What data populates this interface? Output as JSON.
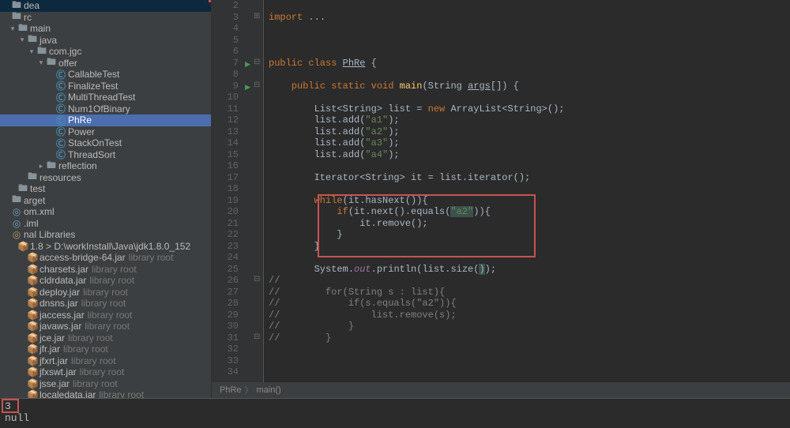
{
  "sidebar": {
    "items": [
      {
        "indent": 0,
        "arrow": "",
        "icon": "F",
        "iconClass": "ic-folder",
        "label": "dea"
      },
      {
        "indent": 0,
        "arrow": "",
        "icon": "F",
        "iconClass": "ic-folder",
        "label": "rc"
      },
      {
        "indent": 1,
        "arrow": "▾",
        "icon": "F",
        "iconClass": "ic-folder",
        "label": "main"
      },
      {
        "indent": 2,
        "arrow": "▾",
        "icon": "F",
        "iconClass": "ic-folder",
        "label": "java"
      },
      {
        "indent": 3,
        "arrow": "▾",
        "icon": "P",
        "iconClass": "ic-package",
        "label": "com.jgc"
      },
      {
        "indent": 4,
        "arrow": "▾",
        "icon": "P",
        "iconClass": "ic-package",
        "label": "offer"
      },
      {
        "indent": 5,
        "arrow": "",
        "icon": "C",
        "iconClass": "ic-class",
        "label": "CallableTest"
      },
      {
        "indent": 5,
        "arrow": "",
        "icon": "C",
        "iconClass": "ic-class",
        "label": "FinalizeTest"
      },
      {
        "indent": 5,
        "arrow": "",
        "icon": "C",
        "iconClass": "ic-class",
        "label": "MultiThreadTest"
      },
      {
        "indent": 5,
        "arrow": "",
        "icon": "C",
        "iconClass": "ic-class",
        "label": "Num1OfBinary"
      },
      {
        "indent": 5,
        "arrow": "",
        "icon": "C",
        "iconClass": "ic-class",
        "label": "PhRe",
        "selected": true
      },
      {
        "indent": 5,
        "arrow": "",
        "icon": "C",
        "iconClass": "ic-class",
        "label": "Power"
      },
      {
        "indent": 5,
        "arrow": "",
        "icon": "C",
        "iconClass": "ic-class",
        "label": "StackOnTest"
      },
      {
        "indent": 5,
        "arrow": "",
        "icon": "C",
        "iconClass": "ic-class",
        "label": "ThreadSort"
      },
      {
        "indent": 4,
        "arrow": "▸",
        "icon": "P",
        "iconClass": "ic-package",
        "label": "reflection"
      },
      {
        "indent": 2,
        "arrow": "",
        "icon": "F",
        "iconClass": "ic-folder",
        "label": "resources"
      },
      {
        "indent": 1,
        "arrow": "",
        "icon": "F",
        "iconClass": "ic-folder",
        "label": "test"
      },
      {
        "indent": 0,
        "arrow": "",
        "icon": "F",
        "iconClass": "ic-folder",
        "label": "arget"
      },
      {
        "indent": 0,
        "arrow": "",
        "icon": "x",
        "iconClass": "ic-xml",
        "label": "om.xml"
      },
      {
        "indent": 0,
        "arrow": "",
        "icon": "i",
        "iconClass": "ic-xml",
        "label": ".iml"
      },
      {
        "indent": 0,
        "arrow": "",
        "icon": "L",
        "iconClass": "ic-lib",
        "label": "nal Libraries"
      },
      {
        "indent": 1,
        "arrow": "",
        "icon": "J",
        "iconClass": "ic-jar",
        "label": "1.8 > D:\\workInstall\\Java\\jdk1.8.0_152"
      },
      {
        "indent": 2,
        "arrow": "",
        "icon": "J",
        "iconClass": "ic-jar",
        "label": "access-bridge-64.jar",
        "note": "library root"
      },
      {
        "indent": 2,
        "arrow": "",
        "icon": "J",
        "iconClass": "ic-jar",
        "label": "charsets.jar",
        "note": "library root"
      },
      {
        "indent": 2,
        "arrow": "",
        "icon": "J",
        "iconClass": "ic-jar",
        "label": "cldrdata.jar",
        "note": "library root"
      },
      {
        "indent": 2,
        "arrow": "",
        "icon": "J",
        "iconClass": "ic-jar",
        "label": "deploy.jar",
        "note": "library root"
      },
      {
        "indent": 2,
        "arrow": "",
        "icon": "J",
        "iconClass": "ic-jar",
        "label": "dnsns.jar",
        "note": "library root"
      },
      {
        "indent": 2,
        "arrow": "",
        "icon": "J",
        "iconClass": "ic-jar",
        "label": "jaccess.jar",
        "note": "library root"
      },
      {
        "indent": 2,
        "arrow": "",
        "icon": "J",
        "iconClass": "ic-jar",
        "label": "javaws.jar",
        "note": "library root"
      },
      {
        "indent": 2,
        "arrow": "",
        "icon": "J",
        "iconClass": "ic-jar",
        "label": "jce.jar",
        "note": "library root"
      },
      {
        "indent": 2,
        "arrow": "",
        "icon": "J",
        "iconClass": "ic-jar",
        "label": "jfr.jar",
        "note": "library root"
      },
      {
        "indent": 2,
        "arrow": "",
        "icon": "J",
        "iconClass": "ic-jar",
        "label": "jfxrt.jar",
        "note": "library root"
      },
      {
        "indent": 2,
        "arrow": "",
        "icon": "J",
        "iconClass": "ic-jar",
        "label": "jfxswt.jar",
        "note": "library root"
      },
      {
        "indent": 2,
        "arrow": "",
        "icon": "J",
        "iconClass": "ic-jar",
        "label": "jsse.jar",
        "note": "library root"
      },
      {
        "indent": 2,
        "arrow": "",
        "icon": "J",
        "iconClass": "ic-jar",
        "label": "localedata.jar",
        "note": "library root"
      }
    ]
  },
  "gutter": {
    "lines": [
      {
        "n": "2"
      },
      {
        "n": "3"
      },
      {
        "n": "4"
      },
      {
        "n": "5"
      },
      {
        "n": "6"
      },
      {
        "n": "7",
        "run": true
      },
      {
        "n": "8"
      },
      {
        "n": "9",
        "run": true
      },
      {
        "n": "10"
      },
      {
        "n": "11"
      },
      {
        "n": "12"
      },
      {
        "n": "13"
      },
      {
        "n": "14"
      },
      {
        "n": "15"
      },
      {
        "n": "16"
      },
      {
        "n": "17"
      },
      {
        "n": "18"
      },
      {
        "n": "19"
      },
      {
        "n": "20"
      },
      {
        "n": "21"
      },
      {
        "n": "22"
      },
      {
        "n": "23"
      },
      {
        "n": "24"
      },
      {
        "n": "25"
      },
      {
        "n": "26"
      },
      {
        "n": "27"
      },
      {
        "n": "28"
      },
      {
        "n": "29"
      },
      {
        "n": "30"
      },
      {
        "n": "31"
      },
      {
        "n": "32"
      },
      {
        "n": "33"
      },
      {
        "n": "34"
      }
    ]
  },
  "fold": {
    "marks": {
      "1": "⊞",
      "5": "⊟",
      "7": "⊟",
      "24": "⊟",
      "29": "⊟"
    }
  },
  "code": {
    "l3": {
      "kw": "import ",
      "rest": "..."
    },
    "l7": {
      "kw1": "public class ",
      "cls": "PhRe",
      "rest": " {"
    },
    "l9": {
      "kw1": "public static void ",
      "mtd": "main",
      "rest1": "(String ",
      "arg": "args",
      "rest2": "[]) {"
    },
    "l11": {
      "pre": "List<String> list = ",
      "kw": "new ",
      "rest": "ArrayList<String>();"
    },
    "l12": {
      "pre": "list.add(",
      "str": "\"a1\"",
      "post": ");"
    },
    "l13": {
      "pre": "list.add(",
      "str": "\"a2\"",
      "post": ");"
    },
    "l14": {
      "pre": "list.add(",
      "str": "\"a3\"",
      "post": ");"
    },
    "l15": {
      "pre": "list.add(",
      "str": "\"a4\"",
      "post": ");"
    },
    "l17": "Iterator<String> it = list.iterator();",
    "l19": {
      "kw": "while",
      "rest": "(it.hasNext()){"
    },
    "l20": {
      "kw": "if",
      "pre": "(it.next().equals(",
      "str": "\"a2\"",
      "post": ")){"
    },
    "l21": "it.remove();",
    "l22": "}",
    "l23": "}",
    "l25": {
      "pre": "System.",
      "out": "out",
      "mid": ".println(list.size(",
      "paren": ")",
      "post": ");"
    },
    "l26": "//",
    "l27": {
      "cmt": "//",
      "rest": "        for(String s : list){"
    },
    "l28": {
      "cmt": "//",
      "rest": "            if(s.equals(\"a2\")){"
    },
    "l29": {
      "cmt": "//",
      "rest": "                list.remove(s);"
    },
    "l30": {
      "cmt": "//",
      "rest": "            }"
    },
    "l31": {
      "cmt": "//",
      "rest": "        }"
    }
  },
  "breadcrumbs": {
    "a": "PhRe",
    "b": "main()"
  },
  "console": {
    "line1": "3",
    "line2": "null"
  }
}
